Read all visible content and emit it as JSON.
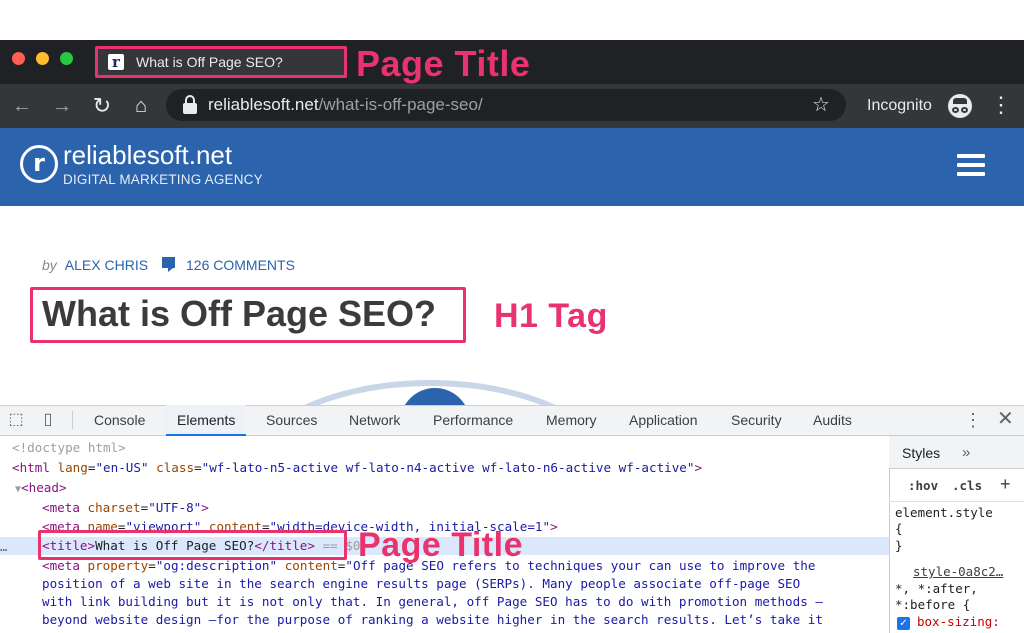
{
  "browser": {
    "tab_title": "What is Off Page SEO?",
    "tab_favicon": "r",
    "url_host": "reliablesoft.net",
    "url_path": "/what-is-off-page-seo/",
    "incognito_label": "Incognito",
    "icons": [
      "back-arrow-icon",
      "forward-arrow-icon",
      "reload-icon",
      "home-icon",
      "lock-icon",
      "star-icon",
      "incognito-icon",
      "more-vert-icon"
    ]
  },
  "annotations": {
    "tab_label": "Page Title",
    "h1_label": "H1 Tag",
    "element_label": "Page Title",
    "color": "#e8336f"
  },
  "site": {
    "logo_letter": "r",
    "name": "reliablesoft.net",
    "tagline": "DIGITAL MARKETING AGENCY",
    "brand_color": "#2b63ad"
  },
  "article": {
    "by": "by",
    "author": "ALEX CHRIS",
    "comments": "126 COMMENTS",
    "title": "What is Off Page SEO?"
  },
  "devtools": {
    "tabs": [
      "Console",
      "Elements",
      "Sources",
      "Network",
      "Performance",
      "Memory",
      "Application",
      "Security",
      "Audits"
    ],
    "active_tab": "Elements",
    "code": {
      "doctype": "<!doctype html>",
      "html_open": "<html",
      "html_lang_attr": "lang",
      "html_lang_val": "\"en-US\"",
      "html_class_attr": "class",
      "html_class_val": "\"wf-lato-n5-active wf-lato-n4-active wf-lato-n6-active wf-active\"",
      "html_close_bracket": ">",
      "head_toggle": "▼",
      "head": "<head>",
      "meta1_open": "<meta",
      "meta1_attr": "charset",
      "meta1_val": "\"UTF-8\"",
      "meta1_close": ">",
      "meta2_open": "<meta",
      "meta2_name_attr": "name",
      "meta2_name_val": "\"viewport\"",
      "meta2_content_attr": "content",
      "meta2_content_val": "\"width=device-width, initial-scale=1\"",
      "meta2_close": ">",
      "title_open": "<title>",
      "title_text": "What is Off Page SEO?",
      "title_close": "</title>",
      "title_suffix": " == $0",
      "meta3_open": "<meta",
      "meta3_prop_attr": "property",
      "meta3_prop_val": "\"og:description\"",
      "meta3_content_attr": "content",
      "meta3_line1": "\"Off page SEO refers to techniques your can use to improve the",
      "meta3_line2": "position of a web site in the search engine results page (SERPs). Many people associate off-page SEO",
      "meta3_line3": "with link building but it is not only that. In general, off Page SEO has to do with promotion methods –",
      "meta3_line4": "beyond website design –for the purpose of ranking a website higher in the search results. Let’s take it",
      "selected_marker": "…"
    },
    "styles": {
      "tab": "Styles",
      "more": "»",
      "hov": ":hov",
      "cls": ".cls",
      "plus": "+",
      "element_style": "element.style",
      "brace_open": "{",
      "brace_close": "}",
      "source_link": "style-0a8c2…",
      "selector_line1": "*, *:after,",
      "selector_line2": "*:before {",
      "prop": "box-sizing:"
    }
  }
}
